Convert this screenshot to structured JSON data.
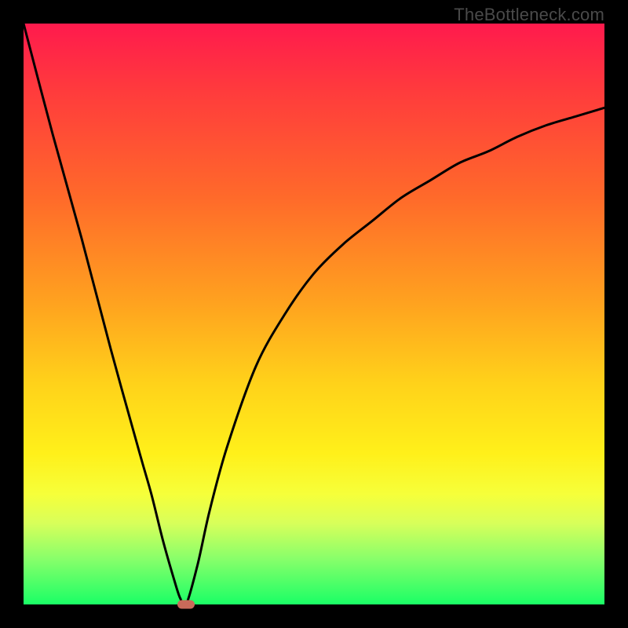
{
  "attribution": "TheBottleneck.com",
  "gradient_colors": [
    "#ff1a4d",
    "#ff3c3c",
    "#ff6a2a",
    "#ffa21f",
    "#ffd21a",
    "#fff01a",
    "#f6ff3a",
    "#d8ff5a",
    "#8aff6a",
    "#1aff66"
  ],
  "chart_data": {
    "type": "line",
    "title": "",
    "xlabel": "",
    "ylabel": "",
    "xlim": [
      0,
      100
    ],
    "ylim": [
      0,
      100
    ],
    "series": [
      {
        "name": "bottleneck-curve",
        "x": [
          0,
          5,
          10,
          15,
          20,
          22,
          24,
          26,
          27,
          28,
          30,
          32,
          35,
          40,
          45,
          50,
          55,
          60,
          65,
          70,
          75,
          80,
          85,
          90,
          95,
          100
        ],
        "values": [
          100,
          81,
          63,
          44,
          26,
          19,
          11,
          4,
          1,
          0,
          7,
          16,
          27,
          41,
          50,
          57,
          62,
          66,
          70,
          73,
          76,
          78,
          80.5,
          82.5,
          84,
          85.5
        ]
      }
    ],
    "marker": {
      "x": 28,
      "y": 0,
      "name": "optimal-point"
    },
    "grid": false,
    "legend": false
  }
}
